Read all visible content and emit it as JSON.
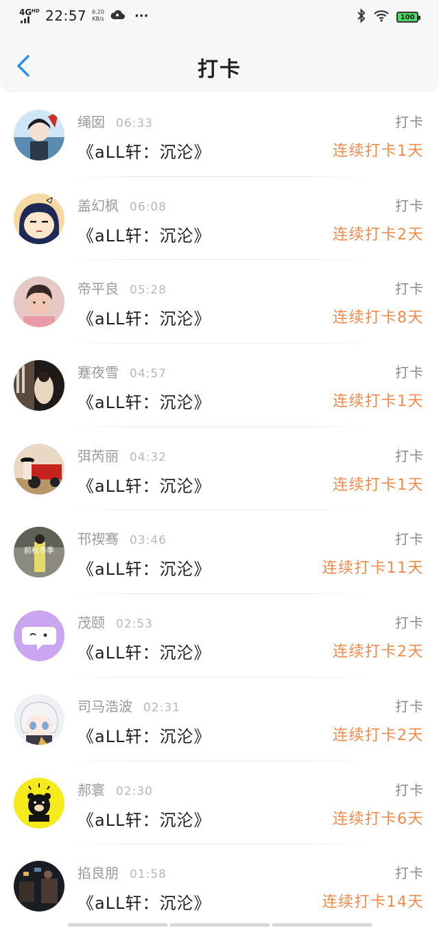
{
  "status_bar": {
    "network": "4G",
    "network_sup": "HD",
    "time": "22:57",
    "speed_value": "6.20",
    "speed_unit": "KB/s",
    "more": "···",
    "battery": "100",
    "battery_color": "#4cd964"
  },
  "nav": {
    "title": "打卡",
    "back_icon": "chevron-left-icon",
    "accent": "#2a8ff0"
  },
  "colors": {
    "streak": "#f08a4b",
    "name": "#9a9a9a"
  },
  "items": [
    {
      "name": "绳囡",
      "time": "06:33",
      "book": "《aLL轩：沉沦》",
      "action": "打卡",
      "streak": "连续打卡1天",
      "avatar": "anime-boy-avatar"
    },
    {
      "name": "盖幻枫",
      "time": "06:08",
      "book": "《aLL轩：沉沦》",
      "action": "打卡",
      "streak": "连续打卡2天",
      "avatar": "cartoon-girl-avatar"
    },
    {
      "name": "帝平良",
      "time": "05:28",
      "book": "《aLL轩：沉沦》",
      "action": "打卡",
      "streak": "连续打卡8天",
      "avatar": "boy-photo-avatar"
    },
    {
      "name": "蹇夜雪",
      "time": "04:57",
      "book": "《aLL轩：沉沦》",
      "action": "打卡",
      "streak": "连续打卡1天",
      "avatar": "dark-photo-avatar"
    },
    {
      "name": "弭芮丽",
      "time": "04:32",
      "book": "《aLL轩：沉沦》",
      "action": "打卡",
      "streak": "连续打卡1天",
      "avatar": "red-tractor-avatar"
    },
    {
      "name": "邗禊骞",
      "time": "03:46",
      "book": "《aLL轩：沉沦》",
      "action": "打卡",
      "streak": "连续打卡11天",
      "avatar": "winter-photo-avatar",
      "avatar_text": "前秋冬季"
    },
    {
      "name": "茂颐",
      "time": "02:53",
      "book": "《aLL轩：沉沦》",
      "action": "打卡",
      "streak": "连续打卡2天",
      "avatar": "chat-bubble-avatar"
    },
    {
      "name": "司马浩波",
      "time": "02:31",
      "book": "《aLL轩：沉沦》",
      "action": "打卡",
      "streak": "连续打卡2天",
      "avatar": "anime-chibi-avatar"
    },
    {
      "name": "郝寰",
      "time": "02:30",
      "book": "《aLL轩：沉沦》",
      "action": "打卡",
      "streak": "连续打卡6天",
      "avatar": "yellow-bear-avatar"
    },
    {
      "name": "掐良朋",
      "time": "01:58",
      "book": "《aLL轩：沉沦》",
      "action": "打卡",
      "streak": "连续打卡14天",
      "avatar": "night-photo-avatar"
    }
  ]
}
